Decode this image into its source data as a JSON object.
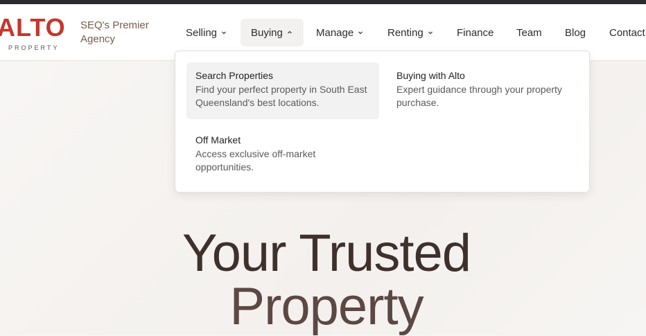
{
  "brand": {
    "logo_text": "ALTO",
    "logo_subtext": "PROPERTY",
    "tagline": "SEQ's Premier Agency",
    "logo_color": "#c8352b"
  },
  "nav": {
    "items": [
      {
        "label": "Selling",
        "has_dropdown": true
      },
      {
        "label": "Buying",
        "has_dropdown": true,
        "expanded": true
      },
      {
        "label": "Manage",
        "has_dropdown": true
      },
      {
        "label": "Renting",
        "has_dropdown": true
      },
      {
        "label": "Finance"
      },
      {
        "label": "Team"
      },
      {
        "label": "Blog"
      },
      {
        "label": "Contact"
      }
    ]
  },
  "buying_menu": {
    "items": [
      {
        "title": "Search Properties",
        "description": "Find your perfect property in South East Queensland's best locations."
      },
      {
        "title": "Buying with Alto",
        "description": "Expert guidance through your property purchase."
      },
      {
        "title": "Off Market",
        "description": "Access exclusive off-market opportunities."
      }
    ]
  },
  "hero": {
    "line1": "Your Trusted",
    "line2": "Property"
  }
}
